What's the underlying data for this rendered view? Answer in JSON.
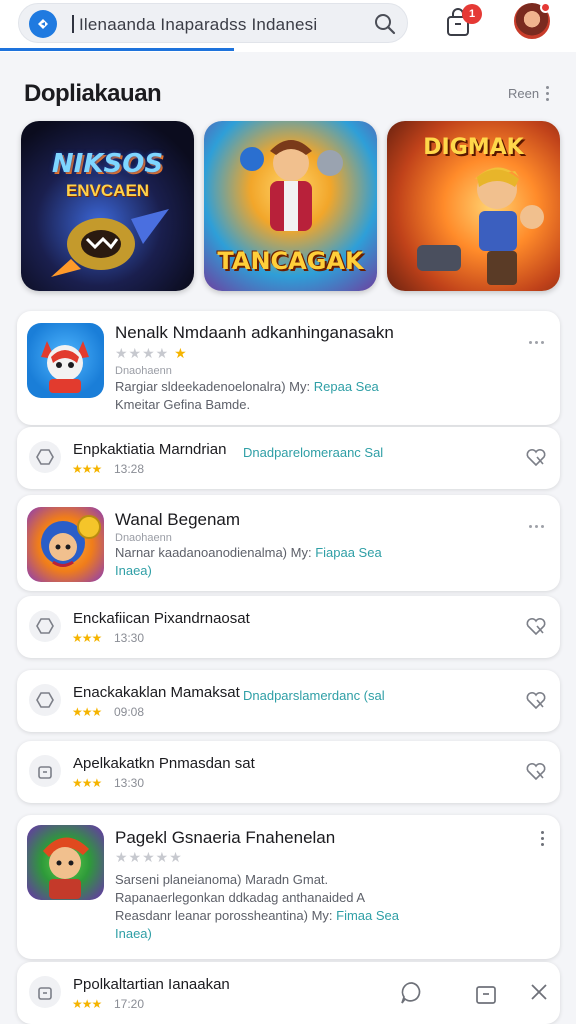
{
  "header": {
    "search_text": "Ilenaanda Inaparadss  Indanesi",
    "badge_count": "1",
    "accent": "#1e73dc"
  },
  "section": {
    "title": "Dopliakauan",
    "more_label": "Reen"
  },
  "featured": [
    {
      "title": "NIKSOS",
      "subtitle": "ENVCAEN"
    },
    {
      "title": "TANCAGAK"
    },
    {
      "title": "DIGMAK"
    }
  ],
  "app1": {
    "title": "Nenalk Nmdaanh adkanhinganasakn",
    "stars_on": 1,
    "stars_total": 5,
    "subtitle": "Dnaohaenn",
    "line1": "Rargiar sldeekadenoelonalra) My:",
    "line1_teal": "Repaa Sea",
    "line2": "Kmeitar Gefina Bamde."
  },
  "row1": {
    "title": "Enpkaktiatia Marndrian",
    "teal": "Dnadparelomeraanc Sal",
    "stars": "★★★",
    "num": "13:28"
  },
  "app2": {
    "title": "Wanal Begenam",
    "subtitle": "Dnaohaenn",
    "line1": "Narnar kaadanoanodienalma) My:",
    "line1_teal": "Fiapaa Sea",
    "line2": "Inaea)"
  },
  "row2": {
    "title": "Enckafiican Pixandrnaosat",
    "stars": "★★★",
    "num": "13:30"
  },
  "row3": {
    "title": "Enackakaklan Mamaksat",
    "teal": "Dnadparslamerdanc (sal",
    "stars": "★★★",
    "num": "09:08"
  },
  "row4": {
    "title": "Apelkakatkn Pnmasdan sat",
    "stars": "★★★",
    "num": "13:30"
  },
  "app3": {
    "title": "Pagekl Gsnaeria Fnahenelan",
    "stars_on": 0,
    "stars_total": 5,
    "line1": "Sarseni planeianoma) Maradn Gmat.",
    "line2": "Rapanaerlegonkan ddkadag anthanaided A",
    "line3": "Reasdanr leanar porossheantina) My:",
    "line3_teal": "Fimaa Sea",
    "line4": "Inaea)"
  },
  "row5": {
    "title": "Ppolkaltartian Ianaakan",
    "stars": "★★★",
    "num": "17:20"
  }
}
